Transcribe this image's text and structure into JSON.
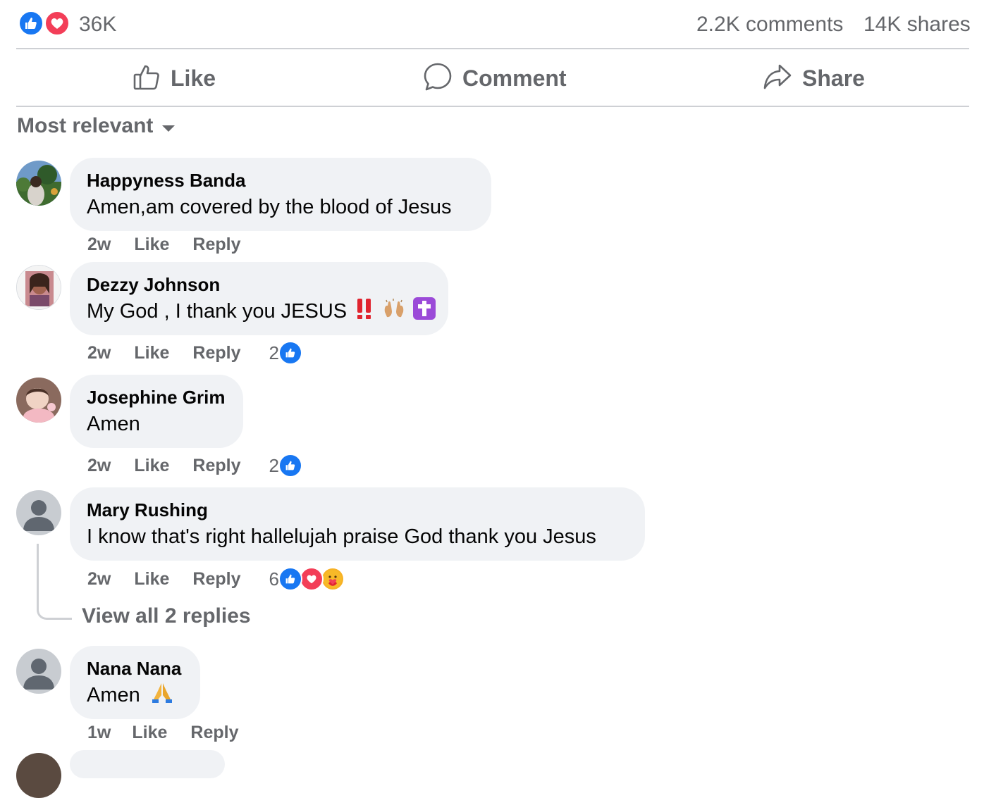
{
  "stats": {
    "reaction_count": "36K",
    "comments": "2.2K comments",
    "shares": "14K shares"
  },
  "actions": {
    "like": "Like",
    "comment": "Comment",
    "share": "Share"
  },
  "sort": {
    "label": "Most relevant"
  },
  "comments": [
    {
      "name": "Happyness Banda",
      "text": "Amen,am covered by the blood of Jesus",
      "time": "2w",
      "like": "Like",
      "reply": "Reply"
    },
    {
      "name": "Dezzy Johnson",
      "text": "My God , I thank you JESUS",
      "time": "2w",
      "like": "Like",
      "reply": "Reply",
      "reaction_count": "2"
    },
    {
      "name": "Josephine Grim",
      "text": "Amen",
      "time": "2w",
      "like": "Like",
      "reply": "Reply",
      "reaction_count": "2"
    },
    {
      "name": "Mary Rushing",
      "text": "I know that's right hallelujah praise God thank you Jesus",
      "time": "2w",
      "like": "Like",
      "reply": "Reply",
      "reaction_count": "6",
      "view_replies": "View all 2 replies"
    },
    {
      "name": "Nana Nana",
      "text": "Amen",
      "time": "1w",
      "like": "Like",
      "reply": "Reply"
    }
  ],
  "colors": {
    "like_blue": "#1877f2",
    "love_red": "#f33e58",
    "bubble_bg": "#f0f2f5",
    "secondary_text": "#65676b"
  },
  "icons": [
    "like-reaction-icon",
    "love-reaction-icon",
    "thumbs-up-icon",
    "comment-icon",
    "share-icon",
    "caret-down-icon",
    "care-reaction-icon",
    "default-avatar-icon"
  ]
}
